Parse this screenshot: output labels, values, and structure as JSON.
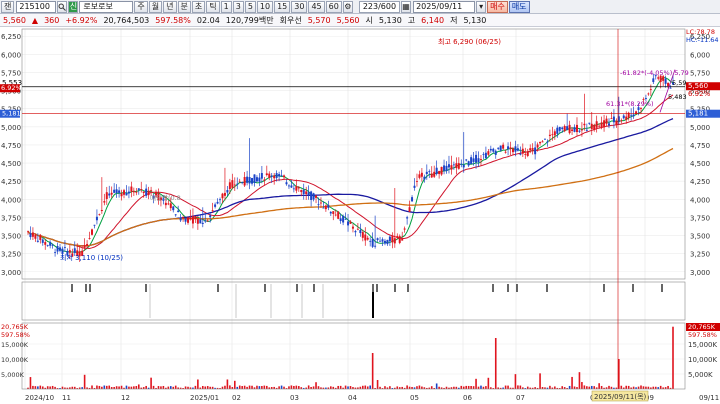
{
  "toolbar": {
    "spin_label": "잰",
    "code": "215100",
    "search_icon": "magnifier-icon",
    "badge": "신",
    "stock_name": "로보로보",
    "period_buttons": [
      "주",
      "월",
      "년",
      "분",
      "초",
      "틱"
    ],
    "interval_buttons": [
      "1",
      "3",
      "5",
      "10",
      "15",
      "30",
      "45",
      "60"
    ],
    "pager": "223/600",
    "date": "2025/09/11",
    "buy_label": "매수",
    "sell_label": "매도"
  },
  "info": {
    "price": "5,560",
    "change": "360",
    "change_pct": "+6.92%",
    "volume": "20,764,503",
    "vol_ratio": "597.58%",
    "time": "02.04",
    "amount": "120,799백만",
    "turnover": "회우선",
    "bid": "5,570",
    "ask": "5,560",
    "open_label": "시",
    "open": "5,130",
    "high_label": "고",
    "high": "6,140",
    "low_label": "저",
    "low": "5,130"
  },
  "colors": {
    "up": "#e0141e",
    "down": "#1a43c8",
    "ma5": "#00a040",
    "ma20": "#d0142c",
    "ma60": "#1a1aa0",
    "ma120": "#d07014",
    "hline": "#000000",
    "accent_blue": "#2e5fd6"
  },
  "price_axis": [
    "6,250",
    "6,000",
    "5,750",
    "5,500",
    "5,250",
    "5,000",
    "4,750",
    "4,500",
    "4,250",
    "4,000",
    "3,750",
    "3,500",
    "3,250",
    "3,000"
  ],
  "volume_axis": [
    "15,000K",
    "10,000K",
    "5,000K"
  ],
  "x_axis": [
    "2024/10",
    "11",
    "12",
    "2025/01",
    "02",
    "03",
    "04",
    "05",
    "06",
    "07",
    "08",
    "09",
    "09/11"
  ],
  "annotations": {
    "max_label": "최고 6,290 (06/25)",
    "min_label": "최저 3,110 (10/25)",
    "left_price": "5,553",
    "right_price_tag": "5,560",
    "right_pct_tag": "6.92%",
    "right_blue_tag": "5,181",
    "right_top1": "LC:78.78",
    "right_top2": "HC:-11.64",
    "pct_up": "-61.82*(-4.05%) 5,79",
    "pct_down": "61.31*(8.29%)",
    "pct_price": "5,483",
    "pct_price2": "5,59",
    "left_pct": "6.92%",
    "left_blue": "5,181",
    "date_tag": "2025/09/11(목)",
    "vol_tag": "20,765K",
    "vol_pct": "597.58%",
    "vol_left1": "20,765K",
    "vol_left2": "597.58%",
    "faint_label": "매당락(0.8"
  }
}
